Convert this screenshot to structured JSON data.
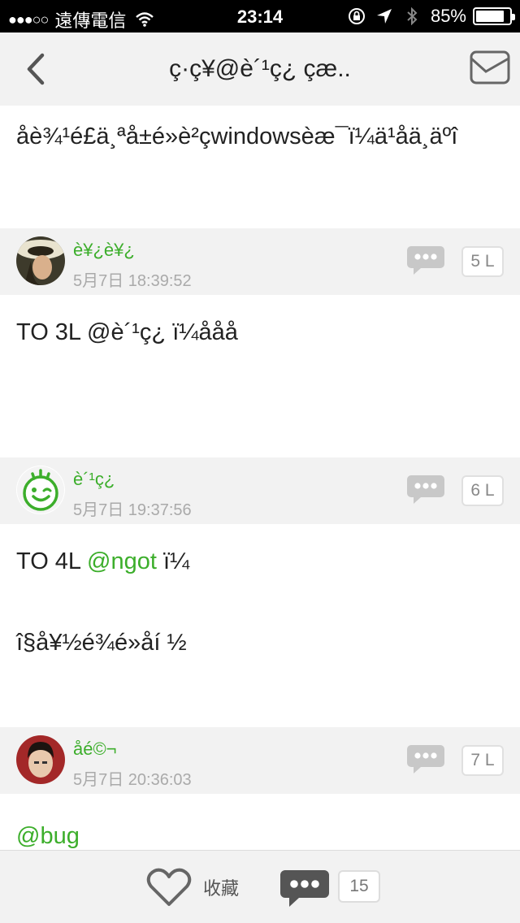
{
  "status_bar": {
    "signal": "●●●○○",
    "carrier": "遠傳電信",
    "time": "23:14",
    "battery": "85%",
    "battery_level": 0.85
  },
  "nav": {
    "title": "ç·ç¥@è´¹ç¿ çæ.."
  },
  "topic": {
    "text": "åè¾¹é£ä¸ªå±é»è²çwindowsèæ¯ï¼ä¹åä¸äºî"
  },
  "replies": [
    {
      "username": "è¥¿è¥¿",
      "time": "5月7日 18:39:52",
      "floor": "5 L",
      "lines": [
        {
          "segments": [
            {
              "text": "TO 3L @è´¹ç¿ ï¼ååå",
              "mention": false
            }
          ]
        }
      ]
    },
    {
      "username": "è´¹ç¿",
      "time": "5月7日 19:37:56",
      "floor": "6 L",
      "lines": [
        {
          "segments": [
            {
              "text": "TO 4L ",
              "mention": false
            },
            {
              "text": "@ngot",
              "mention": true
            },
            {
              "text": " ï¼",
              "mention": false
            }
          ]
        },
        {
          "segments": [
            {
              "text": "î§å¥½é¾é»åí ½",
              "mention": false
            }
          ]
        }
      ]
    },
    {
      "username": "åé©¬",
      "time": "5月7日 20:36:03",
      "floor": "7 L",
      "lines": [
        {
          "segments": [
            {
              "text": "@bug",
              "mention": true
            }
          ]
        }
      ]
    }
  ],
  "toolbar": {
    "favorite_label": "收藏",
    "comment_count": "15"
  },
  "colors": {
    "accent_green": "#3cae2b",
    "header_gray": "#f2f2f2",
    "icon_gray": "#9b9b9b"
  }
}
